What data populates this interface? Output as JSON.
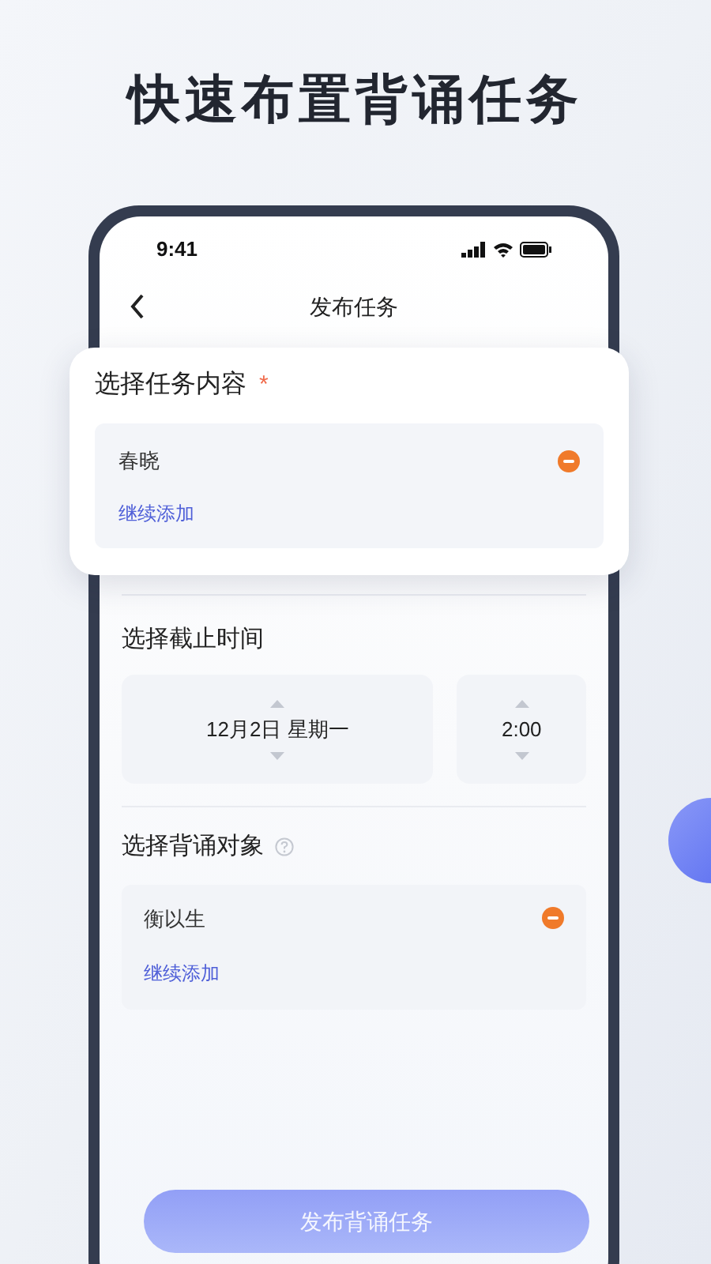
{
  "headline": "快速布置背诵任务",
  "status_bar": {
    "time": "9:41"
  },
  "nav": {
    "title": "发布任务"
  },
  "content_section": {
    "title": "选择任务内容",
    "required_mark": "*",
    "items": [
      {
        "label": "春晓"
      }
    ],
    "add_link": "继续添加"
  },
  "deadline_section": {
    "title": "选择截止时间",
    "date": "12月2日 星期一",
    "time": "2:00"
  },
  "target_section": {
    "title": "选择背诵对象",
    "items": [
      {
        "label": "衡以生"
      }
    ],
    "add_link": "继续添加"
  },
  "submit_button": {
    "label": "发布背诵任务",
    "disabled": true
  }
}
